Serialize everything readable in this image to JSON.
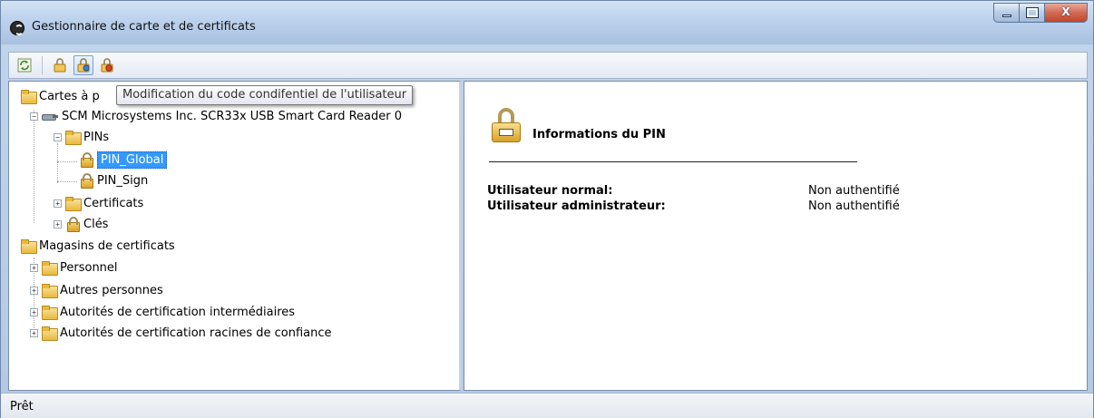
{
  "window": {
    "title": "Gestionnaire de carte et de certificats",
    "controls": {
      "minimize": "–",
      "maximize": "□",
      "close": "X"
    }
  },
  "toolbar": {
    "buttons": [
      {
        "icon": "refresh-icon"
      },
      {
        "icon": "lock-icon"
      },
      {
        "icon": "change-pin-icon"
      },
      {
        "icon": "unblock-pin-icon"
      }
    ],
    "tooltip": "Modification du code condifentiel de l'utilisateur"
  },
  "tree": {
    "root_cards": "Cartes à p",
    "reader": "SCM Microsystems Inc. SCR33x USB Smart Card Reader 0",
    "pins": "PINs",
    "pin_global": "PIN_Global",
    "pin_sign": "PIN_Sign",
    "certificats": "Certificats",
    "cles": "Clés",
    "stores": "Magasins de certificats",
    "personnel": "Personnel",
    "autres": "Autres personnes",
    "intermediaires": "Autorités de certification intermédiaires",
    "racines": "Autorités de certification racines de confiance"
  },
  "details": {
    "title": "Informations du PIN",
    "rows": [
      {
        "label": "Utilisateur normal:",
        "value": "Non authentifié"
      },
      {
        "label": "Utilisateur administrateur:",
        "value": "Non authentifié"
      }
    ]
  },
  "status": {
    "text": "Prêt"
  }
}
